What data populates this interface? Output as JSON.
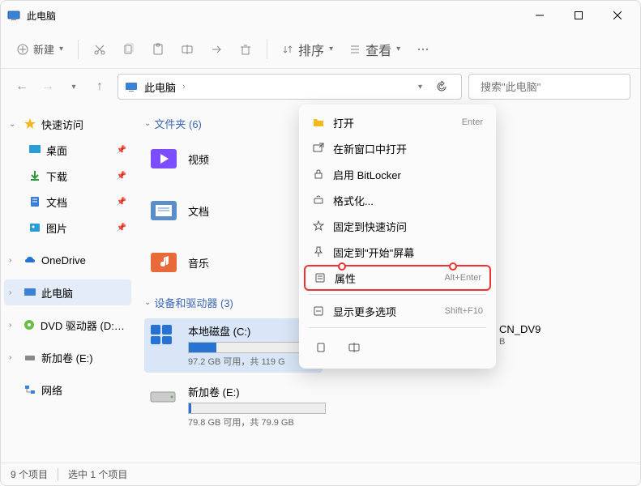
{
  "window": {
    "title": "此电脑"
  },
  "toolbar": {
    "new_label": "新建",
    "sort_label": "排序",
    "view_label": "查看"
  },
  "nav": {
    "breadcrumb": "此电脑",
    "search_placeholder": "搜索\"此电脑\""
  },
  "sidebar": {
    "quick_access": "快速访问",
    "desktop": "桌面",
    "downloads": "下载",
    "documents": "文档",
    "pictures": "图片",
    "onedrive": "OneDrive",
    "this_pc": "此电脑",
    "dvd": "DVD 驱动器 (D:) CC",
    "new_volume_e": "新加卷 (E:)",
    "network": "网络"
  },
  "content": {
    "folders_header": "文件夹 (6)",
    "devices_header": "设备和驱动器 (3)",
    "videos": "视频",
    "documents": "文档",
    "music": "音乐",
    "drive_c": {
      "name": "本地磁盘 (C:)",
      "stats": "97.2 GB 可用，共 119 G",
      "fill_pct": 20
    },
    "drive_e": {
      "name": "新加卷 (E:)",
      "stats": "79.8 GB 可用，共 79.9 GB",
      "fill_pct": 2
    },
    "peeked": {
      "name": "CN_DV9",
      "sub": "B"
    }
  },
  "context_menu": {
    "open": "打开",
    "open_shortcut": "Enter",
    "open_new_window": "在新窗口中打开",
    "bitlocker": "启用 BitLocker",
    "format": "格式化...",
    "pin_quick": "固定到快速访问",
    "pin_start": "固定到\"开始\"屏幕",
    "properties": "属性",
    "properties_shortcut": "Alt+Enter",
    "show_more": "显示更多选项",
    "show_more_shortcut": "Shift+F10"
  },
  "statusbar": {
    "count": "9 个项目",
    "selected": "选中 1 个项目"
  }
}
